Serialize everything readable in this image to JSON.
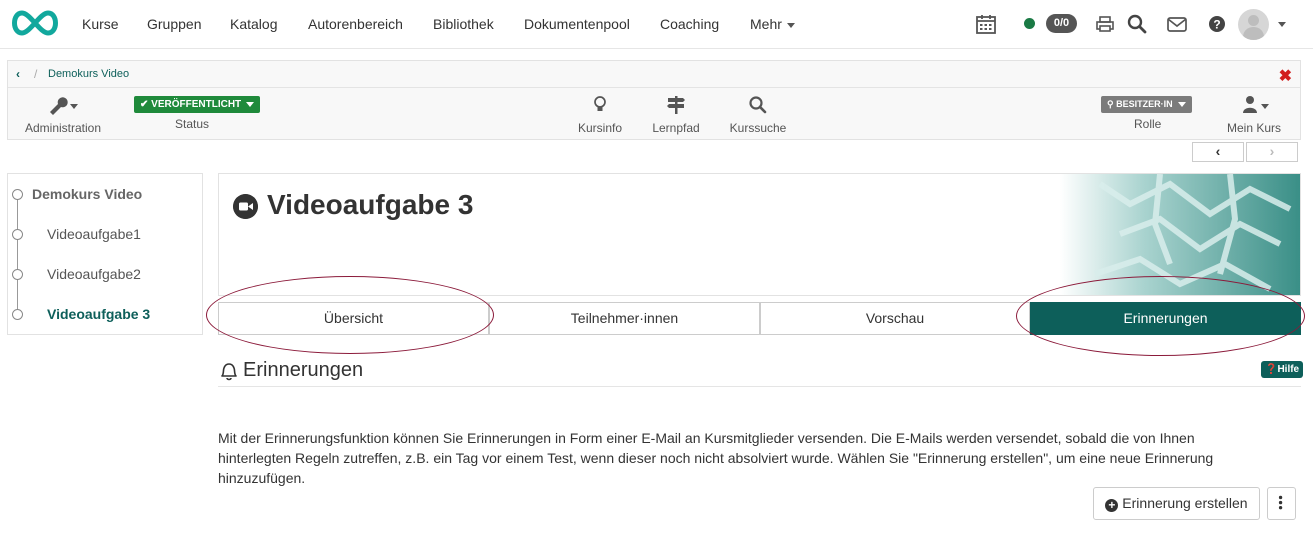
{
  "topnav": {
    "items": [
      "Kurse",
      "Gruppen",
      "Katalog",
      "Autorenbereich",
      "Bibliothek",
      "Dokumentenpool",
      "Coaching",
      "Mehr"
    ],
    "chat_count": "0/0"
  },
  "coursebar": {
    "breadcrumb": "Demokurs Video",
    "admin_label": "Administration",
    "status_button": "VERÖFFENTLICHT",
    "status_label": "Status",
    "tools": [
      "Kursinfo",
      "Lernpfad",
      "Kurssuche"
    ],
    "role_button": "BESITZER·IN",
    "role_label": "Rolle",
    "mycourse_label": "Mein Kurs"
  },
  "menu": {
    "root": "Demokurs Video",
    "items": [
      "Videoaufgabe1",
      "Videoaufgabe2",
      "Videoaufgabe 3"
    ]
  },
  "header": {
    "title": "Videoaufgabe 3"
  },
  "tabs": [
    "Übersicht",
    "Teilnehmer·innen",
    "Vorschau",
    "Erinnerungen"
  ],
  "section": {
    "title": "Erinnerungen",
    "help": "Hilfe",
    "description": "Mit der Erinnerungsfunktion können Sie Erinnerungen in Form einer E-Mail an Kursmitglieder versenden. Die E-Mails werden versendet, sobald die von Ihnen hinterlegten Regeln zutreffen, z.B. ein Tag vor einem Test, wenn dieser noch nicht absolviert wurde. Wählen Sie \"Erinnerung erstellen\", um eine neue Erinnerung hinzuzufügen.",
    "create_button": "Erinnerung erstellen"
  },
  "colors": {
    "accent": "#0d5f5a",
    "published": "#1f8a3b",
    "annotation": "#8b1a3a"
  }
}
